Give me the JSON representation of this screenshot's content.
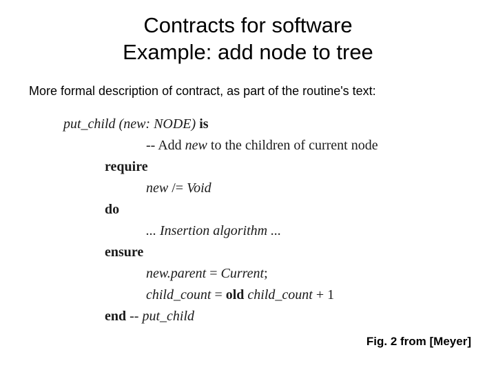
{
  "title_line1": "Contracts for software",
  "title_line2": "Example: add node to tree",
  "subtitle": "More formal description of contract, as part of the routine's text:",
  "code": {
    "sig_name": "put_child ",
    "sig_params": "(new: NODE) ",
    "sig_is": "is",
    "comment": "-- Add ",
    "comment_it": "new",
    "comment_tail": " to the children of current node",
    "require": "require",
    "req_body_it": "new ",
    "req_body": "/= ",
    "req_body_tail": "Void",
    "do": "do",
    "do_body": "... Insertion algorithm ...",
    "ensure": "ensure",
    "ens1_a": "new.parent ",
    "ens1_b": "= ",
    "ens1_c": "Current",
    "ens1_d": ";",
    "ens2_a": "child_count ",
    "ens2_b": "= ",
    "ens2_c": "old ",
    "ens2_d": "child_count ",
    "ens2_e": "+ 1",
    "end_kw": "end ",
    "end_cmt": "-- ",
    "end_it": "put_child"
  },
  "caption": "Fig. 2 from [Meyer]"
}
